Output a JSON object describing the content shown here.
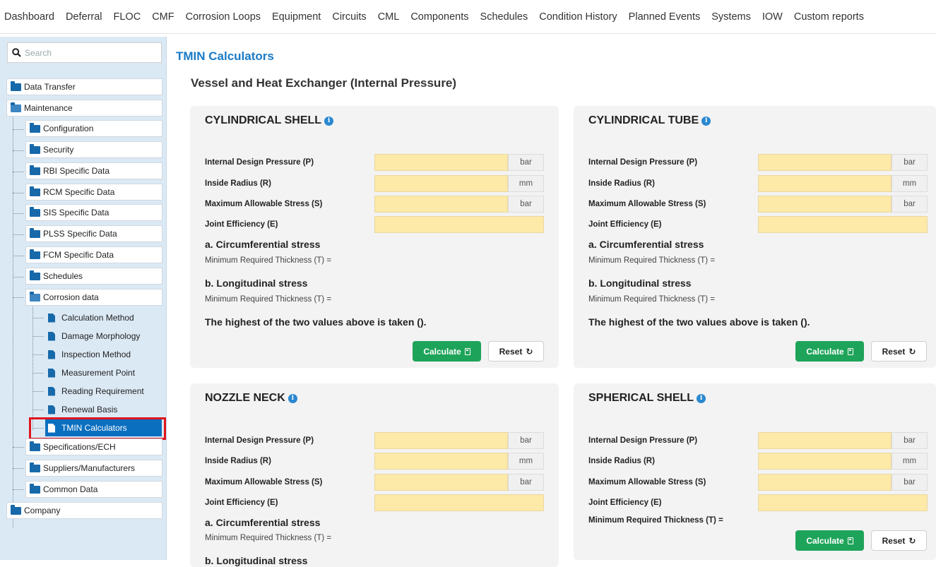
{
  "nav": [
    "Dashboard",
    "Deferral",
    "FLOC",
    "CMF",
    "Corrosion Loops",
    "Equipment",
    "Circuits",
    "CML",
    "Components",
    "Schedules",
    "Condition History",
    "Planned Events",
    "Systems",
    "IOW",
    "Custom reports"
  ],
  "search": {
    "placeholder": "Search"
  },
  "sidebar": {
    "data_transfer": "Data Transfer",
    "maintenance": "Maintenance",
    "children": [
      "Configuration",
      "Security",
      "RBI Specific Data",
      "RCM Specific Data",
      "SIS Specific Data",
      "PLSS Specific Data",
      "FCM Specific Data",
      "Schedules",
      "Corrosion data"
    ],
    "corrosion_children": [
      "Calculation Method",
      "Damage Morphology",
      "Inspection Method",
      "Measurement Point",
      "Reading Requirement",
      "Renewal Basis",
      "TMIN Calculators"
    ],
    "after_corrosion": [
      "Specifications/ECH",
      "Suppliers/Manufacturers",
      "Common Data"
    ],
    "company": "Company"
  },
  "main": {
    "page_title": "TMIN Calculators",
    "section_title": "Vessel and Heat Exchanger (Internal Pressure)",
    "labels": {
      "pressure": "Internal Design Pressure (P)",
      "radius": "Inside Radius (R)",
      "stress": "Maximum Allowable Stress (S)",
      "joint": "Joint Efficiency (E)",
      "circ": "a. Circumferential stress",
      "long": "b. Longitudinal stress",
      "min_thick": "Minimum Required Thickness (T) =",
      "highest": "The highest of the two values above is taken ().",
      "calculate": "Calculate",
      "reset": "Reset",
      "unit_bar": "bar",
      "unit_mm": "mm"
    },
    "cards": {
      "cyl_shell": "CYLINDRICAL SHELL",
      "cyl_tube": "CYLINDRICAL TUBE",
      "nozzle": "NOZZLE NECK",
      "sphere": "SPHERICAL SHELL"
    },
    "cut_text": "b. Longitudinal stress"
  },
  "colors": {
    "accent": "#1a7ac6",
    "input_bg": "#fde9a8",
    "calc_btn": "#1ea45a",
    "selected": "#0b6fc0",
    "highlight": "#e0141e"
  }
}
